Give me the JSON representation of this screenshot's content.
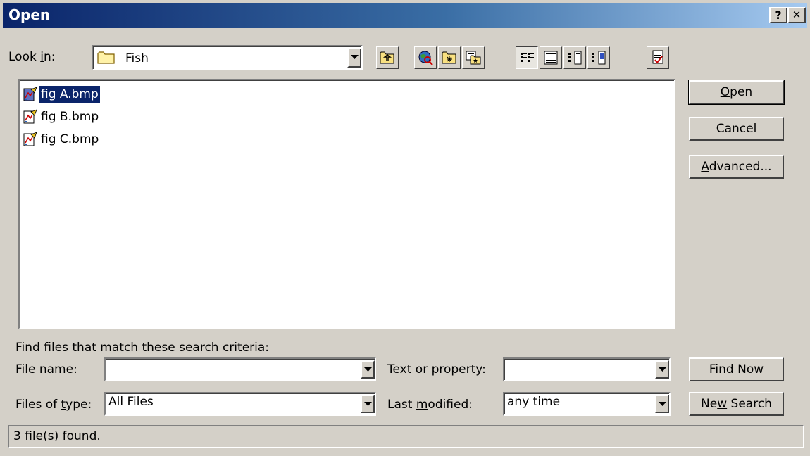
{
  "window": {
    "title": "Open",
    "help_glyph": "?",
    "close_glyph": "✕"
  },
  "lookin": {
    "label_pre": "Look ",
    "label_key": "i",
    "label_post": "n:",
    "folder": "Fish"
  },
  "files": [
    {
      "name": "fig A.bmp",
      "selected": true
    },
    {
      "name": "fig B.bmp",
      "selected": false
    },
    {
      "name": "fig C.bmp",
      "selected": false
    }
  ],
  "buttons": {
    "open_key": "O",
    "open_rest": "pen",
    "cancel": "Cancel",
    "advanced_key": "A",
    "advanced_rest": "dvanced...",
    "findnow_key": "F",
    "findnow_rest": "ind Now",
    "newsearch_pre": "Ne",
    "newsearch_key": "w",
    "newsearch_post": " Search"
  },
  "search": {
    "heading": "Find files that match these search criteria:",
    "filename_pre": "File ",
    "filename_key": "n",
    "filename_post": "ame:",
    "filename_value": "",
    "filetype_pre": "Files of ",
    "filetype_key": "t",
    "filetype_post": "ype:",
    "filetype_value": "All Files",
    "textprop_pre": "Te",
    "textprop_key": "x",
    "textprop_post": "t or property:",
    "textprop_value": "",
    "lastmod_pre": "Last ",
    "lastmod_key": "m",
    "lastmod_post": "odified:",
    "lastmod_value": "any time"
  },
  "status": "3 file(s) found."
}
